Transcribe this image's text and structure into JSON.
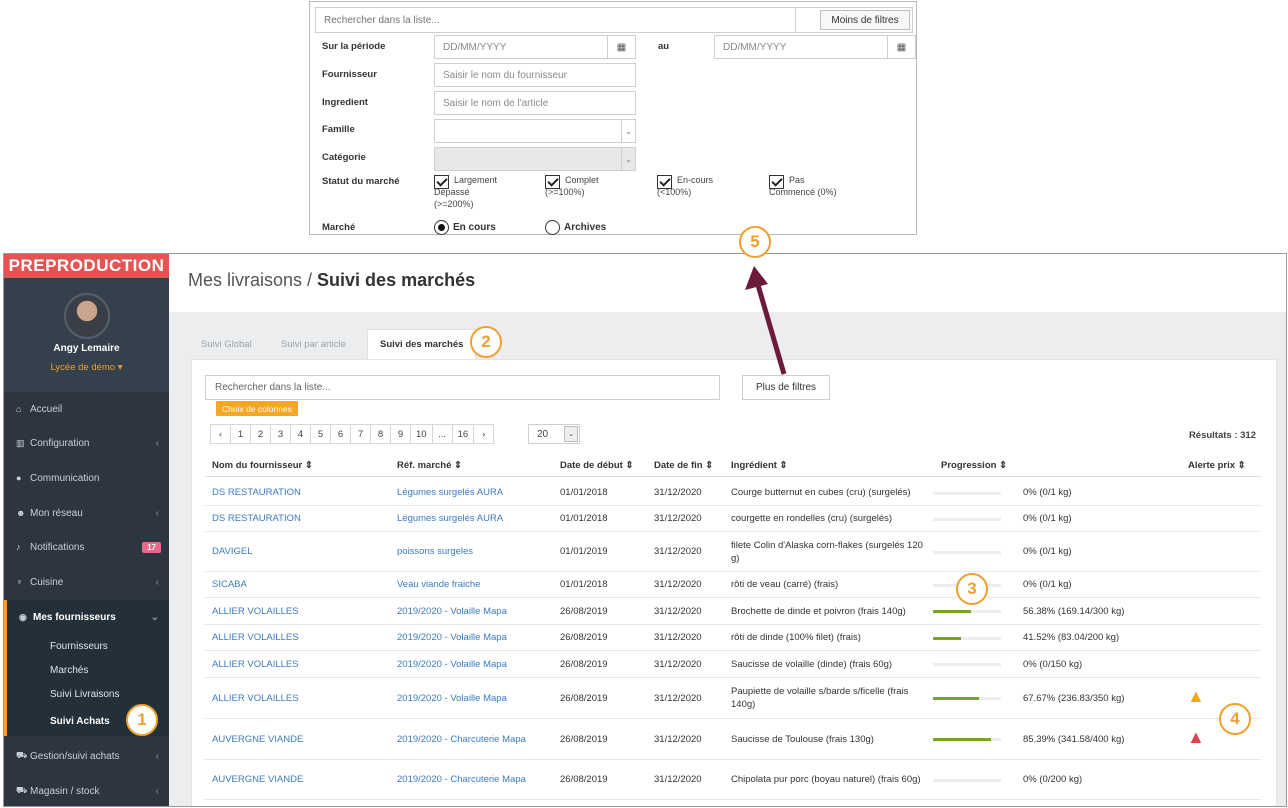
{
  "filter_panel": {
    "search_placeholder": "Rechercher dans la liste...",
    "less_filters": "Moins de filtres",
    "period_label": "Sur la période",
    "date_placeholder": "DD/MM/YYYY",
    "au_label": "au",
    "supplier_label": "Fournisseur",
    "supplier_placeholder": "Saisir le nom du fournisseur",
    "ingredient_label": "Ingredient",
    "ingredient_placeholder": "Saisir le nom de l'article",
    "family_label": "Famille",
    "category_label": "Catégorie",
    "status_label": "Statut du marché",
    "status_options": [
      {
        "line1": "Largement",
        "line2": "Dépassé",
        "line3": "(>=200%)",
        "checked": true
      },
      {
        "line1": "Complet",
        "line2": "(>=100%)",
        "line3": "",
        "checked": true
      },
      {
        "line1": "En-cours",
        "line2": "(<100%)",
        "line3": "",
        "checked": true
      },
      {
        "line1": "Pas",
        "line2": "Commencé (0%)",
        "line3": "",
        "checked": true
      }
    ],
    "market_label": "Marché",
    "market_options": [
      {
        "label": "En cours",
        "selected": true
      },
      {
        "label": "Archives",
        "selected": false
      }
    ]
  },
  "sidebar": {
    "env_badge": "PREPRODUCTION",
    "user_name": "Angy Lemaire",
    "school": "Lycée de démo ▾",
    "items": [
      {
        "label": "Accueil",
        "icon": "home-icon",
        "glyph": "⌂"
      },
      {
        "label": "Configuration",
        "icon": "bank-icon",
        "glyph": "▥"
      },
      {
        "label": "Communication",
        "icon": "chat-icon",
        "glyph": "●"
      },
      {
        "label": "Mon réseau",
        "icon": "users-icon",
        "glyph": "☻"
      },
      {
        "label": "Notifications",
        "icon": "bell-icon",
        "glyph": "♪",
        "badge": "17"
      },
      {
        "label": "Cuisine",
        "icon": "cutlery-icon",
        "glyph": "♆"
      },
      {
        "label": "Mes fournisseurs",
        "icon": "eye-icon",
        "glyph": "◉"
      }
    ],
    "sub_items": [
      "Fournisseurs",
      "Marchés",
      "Suivi Livraisons",
      "Suivi Achats"
    ],
    "bottom_items": [
      {
        "label": "Gestion/suivi achats",
        "icon": "cart-icon",
        "glyph": "⛟"
      },
      {
        "label": "Magasin / stock",
        "icon": "truck-icon",
        "glyph": "⛟"
      }
    ]
  },
  "header": {
    "crumb": "Mes livraisons / ",
    "title": "Suivi des marchés"
  },
  "tabs": [
    "Suivi Global",
    "Suivi par article",
    "Suivi des marchés"
  ],
  "list": {
    "search_placeholder": "Rechercher dans la liste...",
    "more_filters": "Plus de filtres",
    "column_choice": "Choix de colonnes",
    "pages": [
      "‹",
      "1",
      "2",
      "3",
      "4",
      "5",
      "6",
      "7",
      "8",
      "9",
      "10",
      "...",
      "16",
      "›"
    ],
    "page_size": "20",
    "results": "Résultats : 312",
    "columns": [
      "Nom du fournisseur ⇕",
      "Réf. marché ⇕",
      "Date de début ⇕",
      "Date de fin ⇕",
      "Ingrédient ⇕",
      "Progression ⇕",
      "Alerte prix ⇕"
    ],
    "rows": [
      {
        "supplier": "DS RESTAURATION",
        "ref": "Légumes surgelés AURA",
        "start": "01/01/2018",
        "end": "31/12/2020",
        "ingredient": "Courge butternut en cubes (cru) (surgelés)",
        "progress": 0,
        "progress_text": "0% (0/1 kg)",
        "alert": ""
      },
      {
        "supplier": "DS RESTAURATION",
        "ref": "Légumes surgelés AURA",
        "start": "01/01/2018",
        "end": "31/12/2020",
        "ingredient": "courgette en rondelles (cru) (surgelés)",
        "progress": 0,
        "progress_text": "0% (0/1 kg)",
        "alert": ""
      },
      {
        "supplier": "DAVIGEL",
        "ref": "poissons surgeles",
        "start": "01/01/2019",
        "end": "31/12/2020",
        "ingredient": "filete Colin d'Alaska corn-flakes (surgelés 120 g)",
        "progress": 0,
        "progress_text": "0% (0/1 kg)",
        "alert": ""
      },
      {
        "supplier": "SICABA",
        "ref": "Veau viande fraiche",
        "start": "01/01/2018",
        "end": "31/12/2020",
        "ingredient": "rôti de veau (carré) (frais)",
        "progress": 0,
        "progress_text": "0% (0/1 kg)",
        "alert": ""
      },
      {
        "supplier": "ALLIER VOLAILLES",
        "ref": "2019/2020 - Volaille Mapa",
        "start": "26/08/2019",
        "end": "31/12/2020",
        "ingredient": "Brochette de dinde et poivron (frais 140g)",
        "progress": 56.38,
        "progress_text": "56.38% (169.14/300 kg)",
        "alert": ""
      },
      {
        "supplier": "ALLIER VOLAILLES",
        "ref": "2019/2020 - Volaille Mapa",
        "start": "26/08/2019",
        "end": "31/12/2020",
        "ingredient": "rôti de dinde (100% filet) (frais)",
        "progress": 41.52,
        "progress_text": "41.52% (83.04/200 kg)",
        "alert": ""
      },
      {
        "supplier": "ALLIER VOLAILLES",
        "ref": "2019/2020 - Volaille Mapa",
        "start": "26/08/2019",
        "end": "31/12/2020",
        "ingredient": "Saucisse de volaille (dinde) (frais 60g)",
        "progress": 0,
        "progress_text": "0% (0/150 kg)",
        "alert": ""
      },
      {
        "supplier": "ALLIER VOLAILLES",
        "ref": "2019/2020 - Volaille Mapa",
        "start": "26/08/2019",
        "end": "31/12/2020",
        "ingredient": "Paupiette de volaille s/barde s/ficelle (frais 140g)",
        "progress": 67.67,
        "progress_text": "67.67% (236.83/350 kg)",
        "alert": "orange"
      },
      {
        "supplier": "AUVERGNE VIANDE",
        "ref": "2019/2020 - Charcuterie Mapa",
        "start": "26/08/2019",
        "end": "31/12/2020",
        "ingredient": "Saucisse de Toulouse (frais 130g)",
        "progress": 85.39,
        "progress_text": "85.39% (341.58/400 kg)",
        "alert": "red"
      },
      {
        "supplier": "AUVERGNE VIANDE",
        "ref": "2019/2020 - Charcuterie Mapa",
        "start": "26/08/2019",
        "end": "31/12/2020",
        "ingredient": "Chipolata pur porc (boyau naturel) (frais 60g)",
        "progress": 0,
        "progress_text": "0% (0/200 kg)",
        "alert": ""
      }
    ]
  },
  "annotations": [
    "1",
    "2",
    "3",
    "4",
    "5"
  ],
  "colors": {
    "accent": "#f0a030",
    "link": "#3a7bbf",
    "progress": "#7aa22e",
    "arrow": "#6b1a3c",
    "badge": "#e55453",
    "warn_orange": "#f5a623",
    "warn_red": "#e0434b"
  }
}
